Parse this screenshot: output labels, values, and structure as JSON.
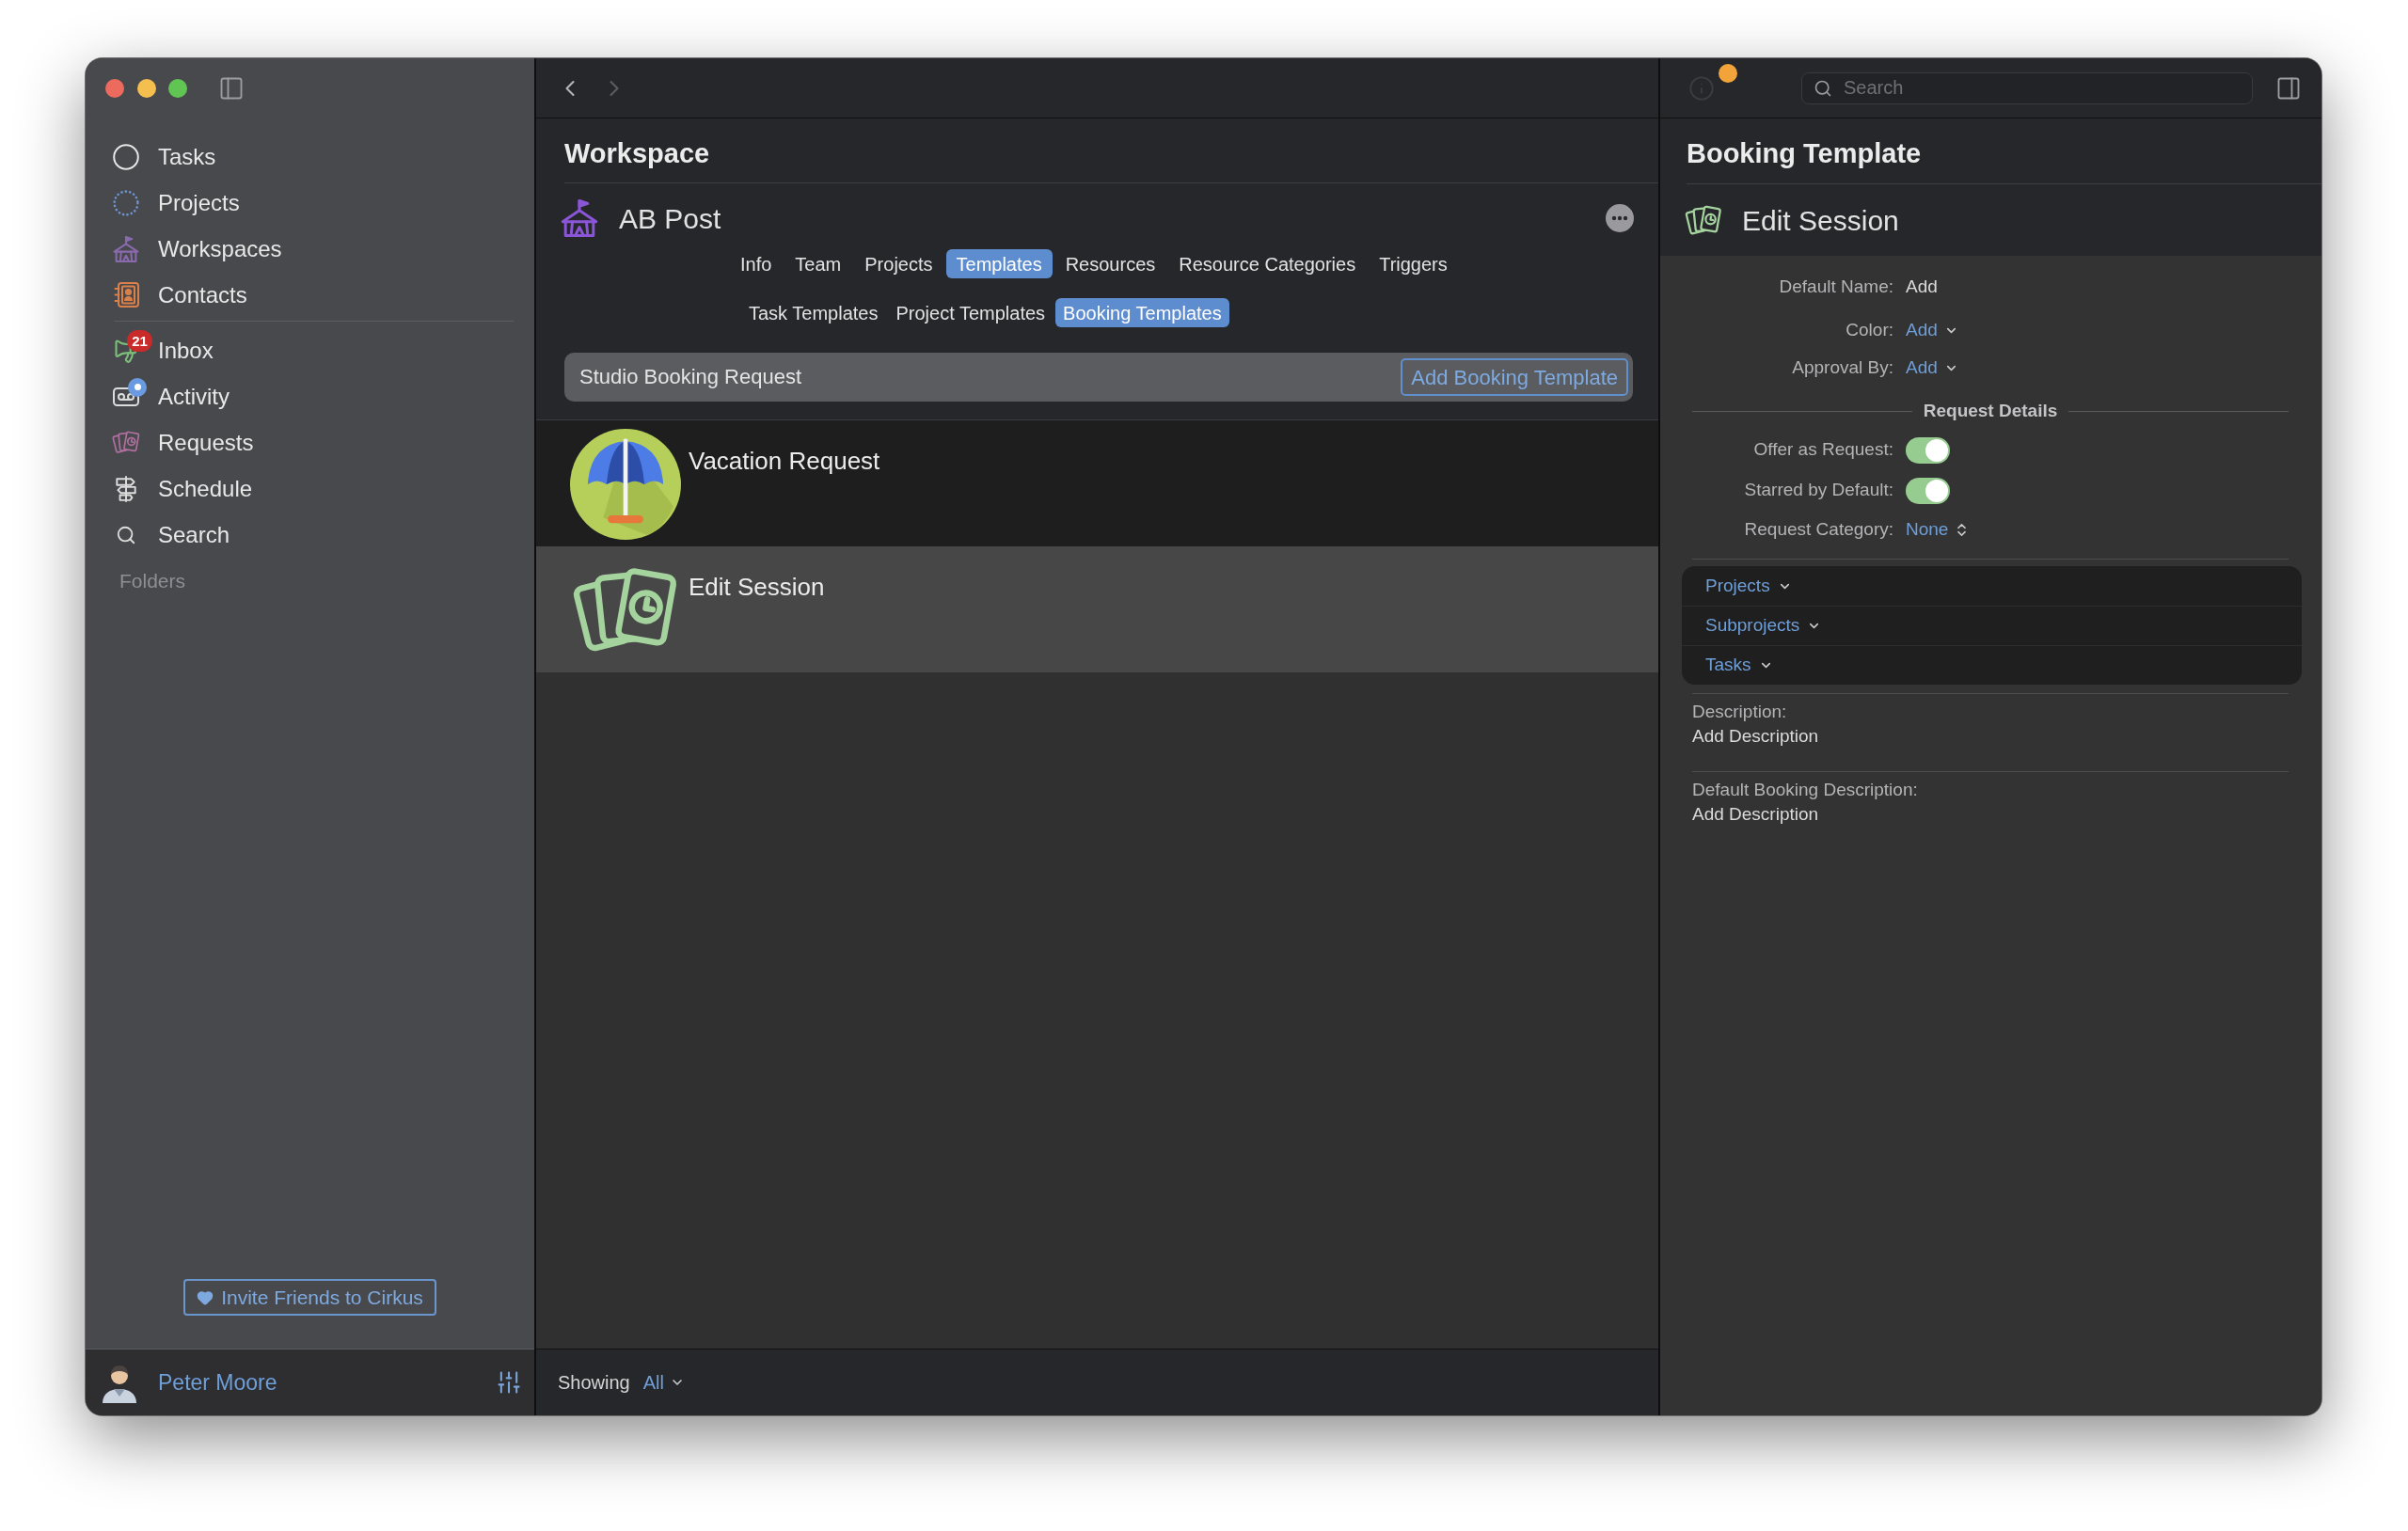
{
  "sidebar": {
    "groups": [
      {
        "items": [
          {
            "label": "Tasks",
            "selected": false,
            "dot": false
          },
          {
            "label": "Projects",
            "selected": false,
            "dot": false
          },
          {
            "label": "Workspaces",
            "selected": false,
            "dot": false
          },
          {
            "label": "Contacts",
            "selected": false,
            "dot": false
          }
        ]
      },
      {
        "items": [
          {
            "label": "Inbox",
            "badge": "21",
            "selected": false,
            "dot": false
          },
          {
            "label": "Activity",
            "selected": false,
            "dot": true
          },
          {
            "label": "Requests",
            "selected": false,
            "dot": false
          },
          {
            "label": "Schedule",
            "selected": false,
            "dot": false
          },
          {
            "label": "Search",
            "selected": false,
            "dot": false
          }
        ]
      }
    ],
    "section": "Folders",
    "invite_button": "Invite Friends to Cirkus",
    "user": {
      "name": "Peter Moore"
    }
  },
  "navigation": {
    "back": {
      "disabled": false
    },
    "forward": {
      "disabled": true
    }
  },
  "main": {
    "title": "Workspace",
    "workspace": {
      "name": "AB Post"
    },
    "tabs": [
      {
        "label": "Info",
        "selected": false
      },
      {
        "label": "Team",
        "selected": false
      },
      {
        "label": "Projects",
        "selected": false
      },
      {
        "label": "Templates",
        "selected": true
      },
      {
        "label": "Resources",
        "selected": false
      },
      {
        "label": "Resource Categories",
        "selected": false
      },
      {
        "label": "Triggers",
        "selected": false
      }
    ],
    "subtabs": [
      {
        "label": "Task Templates",
        "selected": false
      },
      {
        "label": "Project Templates",
        "selected": false
      },
      {
        "label": "Booking Templates",
        "selected": true
      }
    ],
    "new_template": {
      "value": "Studio Booking Request",
      "button": "Add Booking Template"
    },
    "templates": [
      {
        "name": "Vacation Request",
        "selected": false
      },
      {
        "name": "Edit Session",
        "selected": true
      }
    ],
    "footer": {
      "label": "Showing",
      "filter": "All"
    }
  },
  "inspector": {
    "toolbar": {
      "info": {
        "disabled": true
      },
      "search": {
        "placeholder": "Search"
      }
    },
    "title": "Booking Template",
    "item": {
      "name": "Edit Session"
    },
    "fields": [
      {
        "kind": "text",
        "label": "Default Name:",
        "value": "Add"
      },
      {
        "kind": "menu",
        "label": "Color:",
        "value": "Add"
      },
      {
        "kind": "menu",
        "label": "Approval By:",
        "value": "Add"
      }
    ],
    "request_details": {
      "title": "Request Details",
      "fields": [
        {
          "kind": "toggle",
          "label": "Offer as Request:",
          "on": true
        },
        {
          "kind": "toggle",
          "label": "Starred by Default:",
          "on": true
        },
        {
          "kind": "stepper",
          "label": "Request Category:",
          "value": "None"
        }
      ]
    },
    "links": [
      {
        "label": "Projects"
      },
      {
        "label": "Subprojects"
      },
      {
        "label": "Tasks"
      }
    ],
    "descriptions": [
      {
        "label": "Description:",
        "value": "Add Description"
      },
      {
        "label": "Default Booking Description:",
        "value": "Add Description"
      }
    ]
  }
}
